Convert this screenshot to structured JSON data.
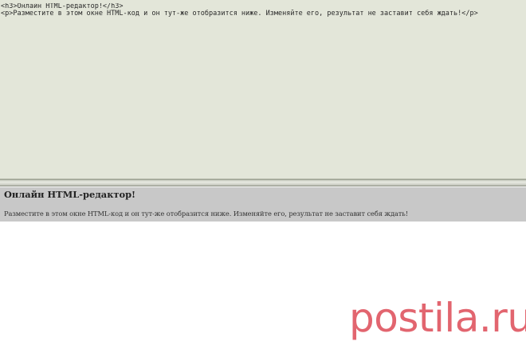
{
  "editor": {
    "code": "<h3>Онлайн HTML-редактор!</h3>\n<p>Разместите в этом окне HTML-код и он тут-же отобразится ниже. Изменяйте его, результат не заставит себя ждать!</p>"
  },
  "preview": {
    "heading": "Онлайн HTML-редактор!",
    "paragraph": "Разместите в этом окне HTML-код и он тут-же отобразится ниже. Изменяйте его, результат не заставит себя ждать!"
  },
  "watermark": {
    "text": "postila.ru"
  }
}
